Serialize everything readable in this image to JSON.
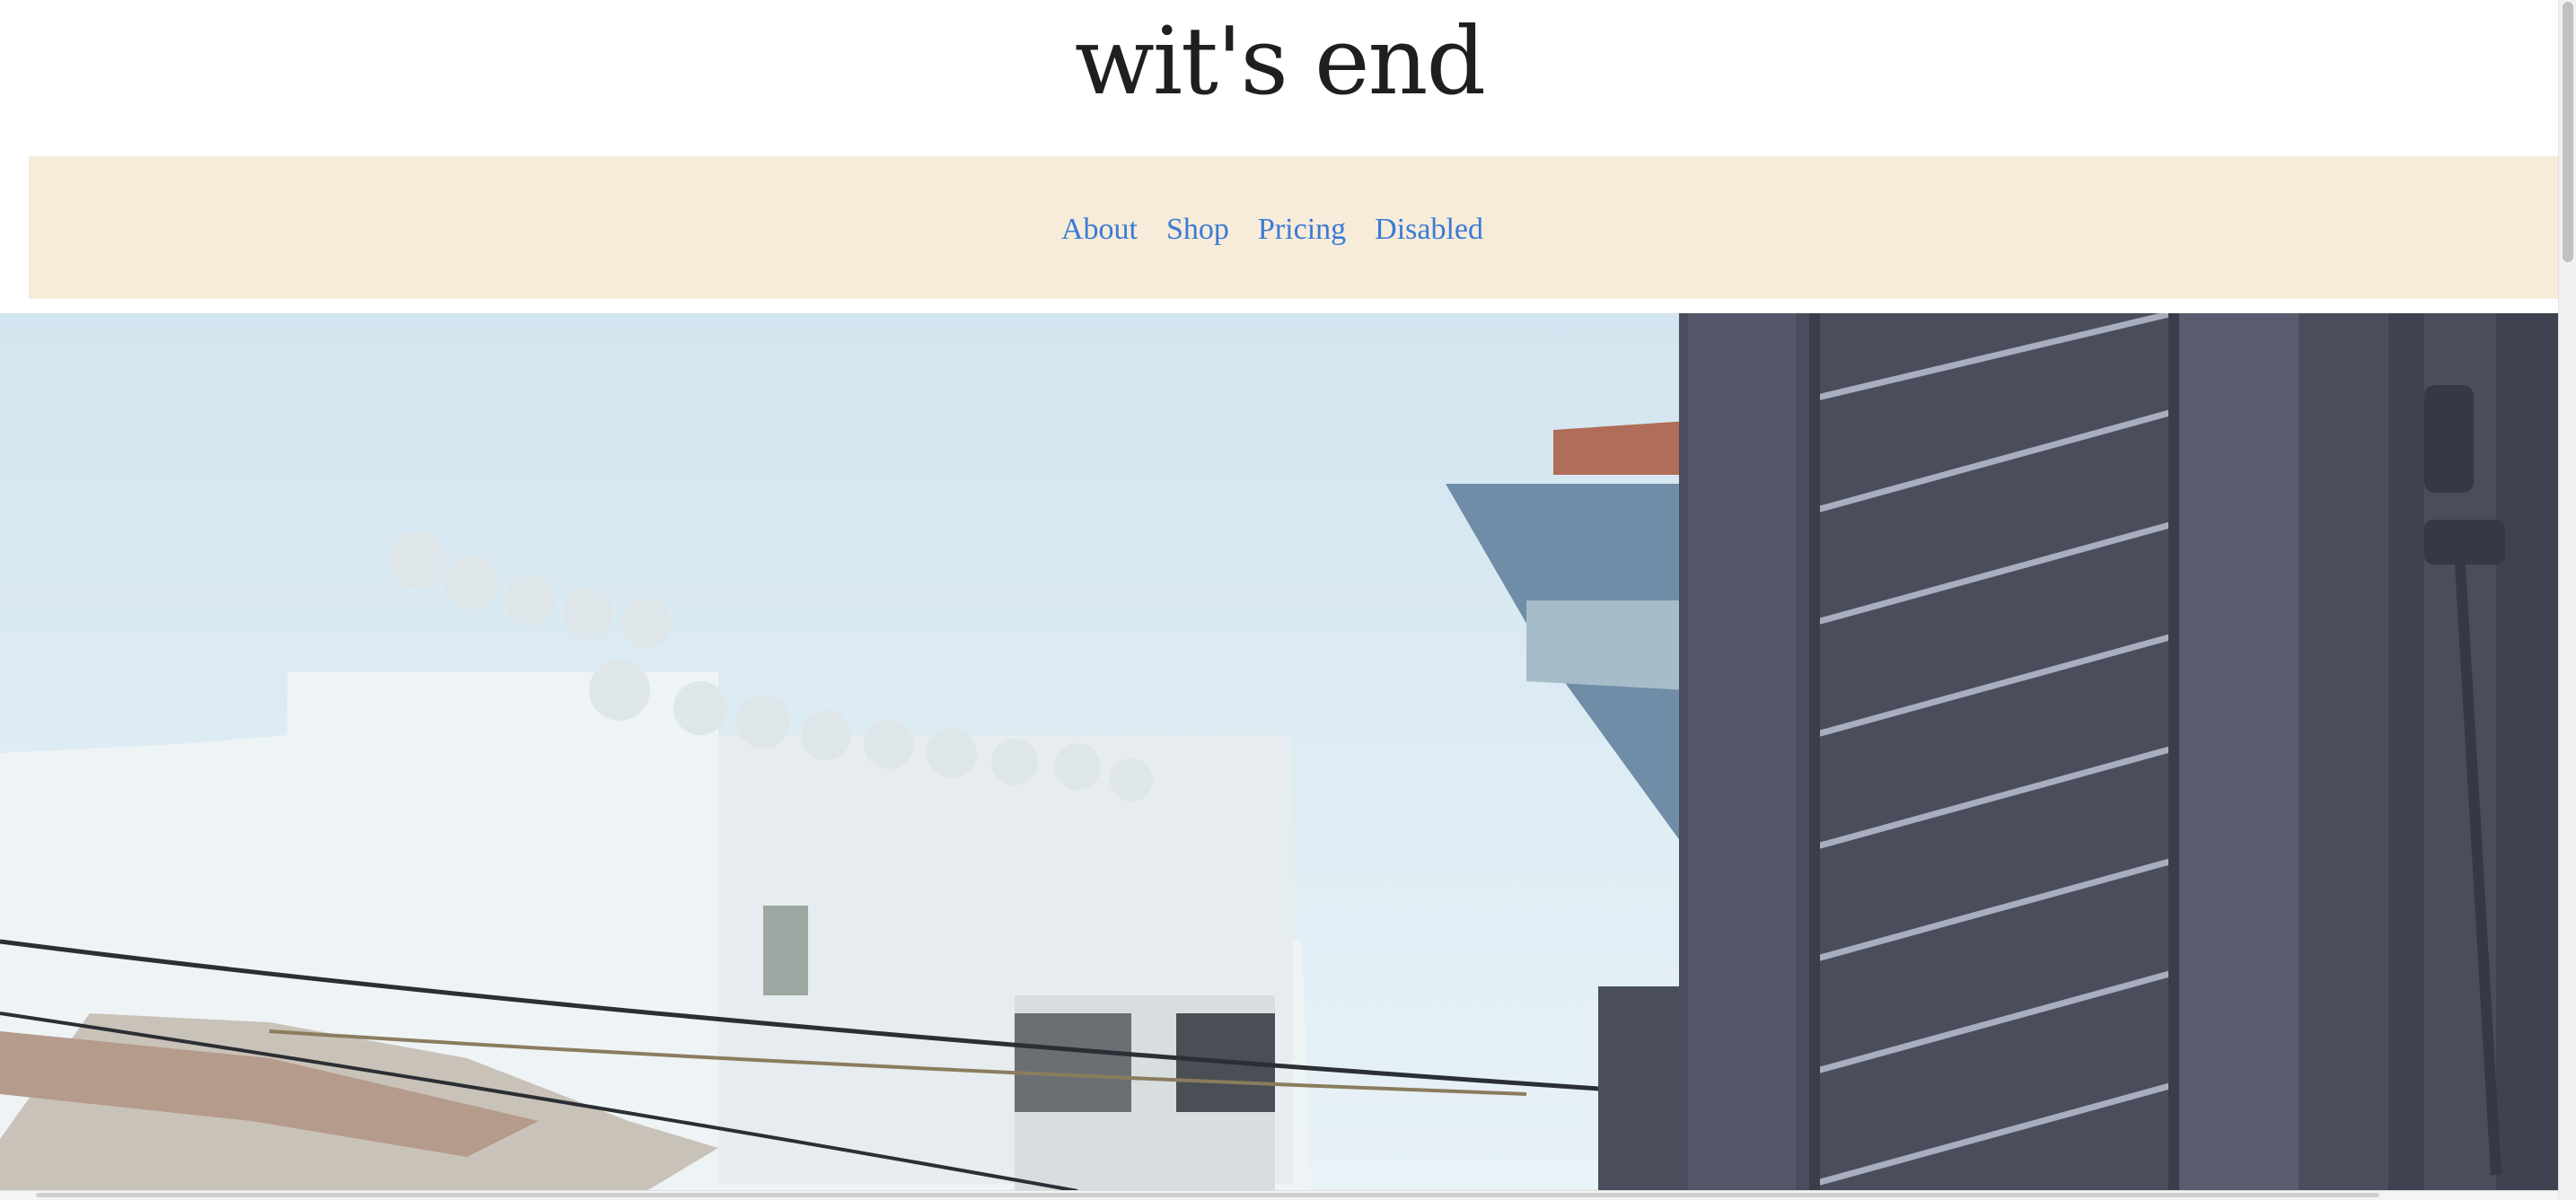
{
  "site": {
    "title": "wit's end"
  },
  "nav": {
    "items": [
      {
        "label": "About"
      },
      {
        "label": "Shop"
      },
      {
        "label": "Pricing"
      },
      {
        "label": "Disabled"
      }
    ]
  },
  "hero": {
    "image": "photo of white rooftop buildings with water heaters beside a dark gray window shutter"
  },
  "colors": {
    "nav_background": "#f7ebda",
    "link": "#3a7bd5",
    "title": "#1f1f1f",
    "sky": "#dbe9f2",
    "shutter": "#4a4d5c"
  }
}
